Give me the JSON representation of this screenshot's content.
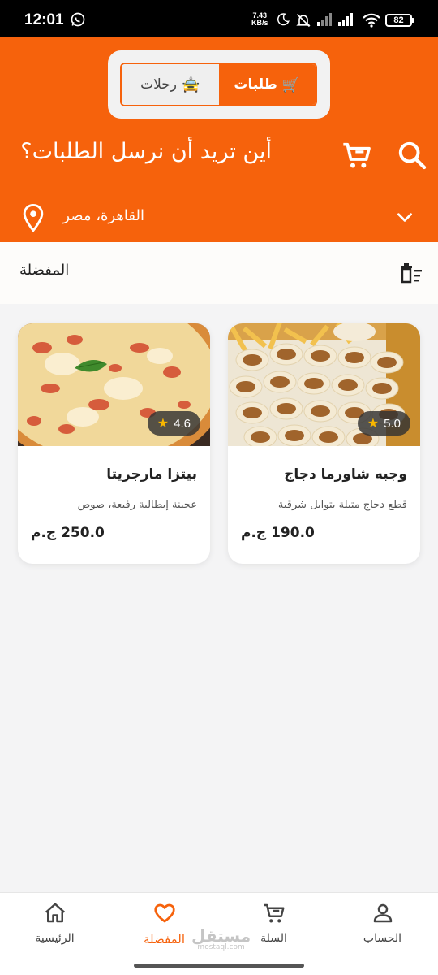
{
  "status_bar": {
    "time": "12:01",
    "net_speed_value": "7.43",
    "net_speed_unit": "KB/s",
    "battery": "82",
    "icons": [
      "whatsapp-icon",
      "moon-icon",
      "mute-icon",
      "signal-icon",
      "signal-icon",
      "wifi-icon",
      "battery-icon"
    ]
  },
  "mode_switch": {
    "rides_label": "رحلات",
    "rides_icon": "🚖",
    "orders_label": "طلبات",
    "orders_icon": "🛒",
    "active": "orders"
  },
  "header": {
    "title": "أين تريد أن نرسل الطلبات؟",
    "location": "القاهرة، مصر",
    "accent_color": "#f6620c"
  },
  "favorites": {
    "title": "المفضلة"
  },
  "cards": [
    {
      "name": "وجبه شاورما دجاج",
      "description": "قطع دجاج متبلة بتوابل شرقية",
      "price": "190.0 ج.م",
      "rating": "5.0"
    },
    {
      "name": "بيتزا مارجريتا",
      "description": "عجينة إيطالية رفيعة، صوص",
      "price": "250.0 ج.م",
      "rating": "4.6"
    }
  ],
  "bottom_nav": {
    "account": "الحساب",
    "cart": "السلة",
    "favorites": "المفضلة",
    "home": "الرئيسية",
    "active": "favorites"
  },
  "watermark": {
    "text": "مستقل",
    "sub": "mostaql.com"
  }
}
